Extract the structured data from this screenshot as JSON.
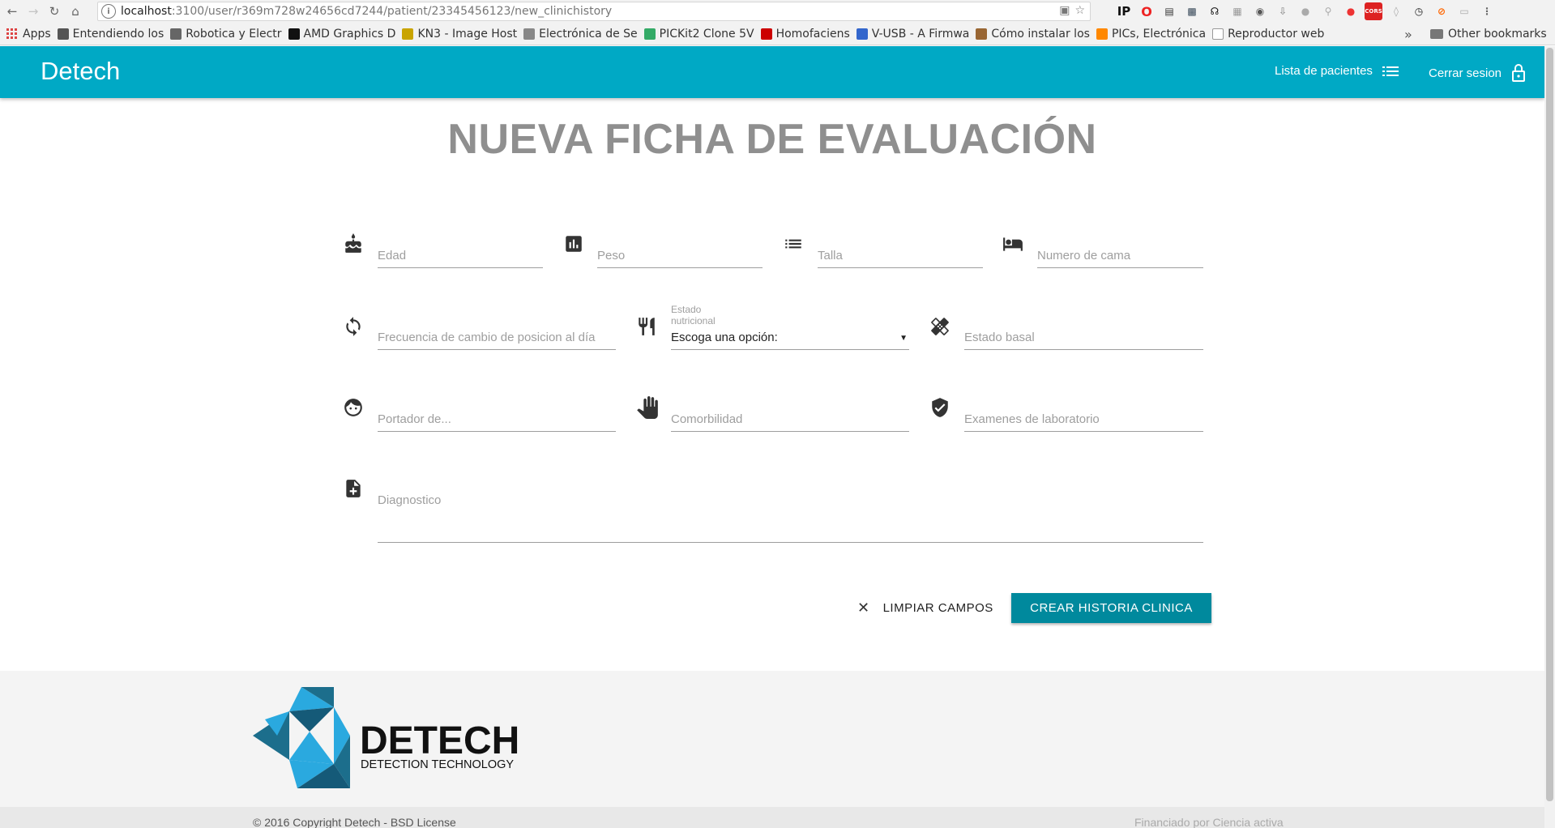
{
  "browser": {
    "url_host": "localhost",
    "url_path": ":3100/user/r369m728w24656cd7244/patient/23345456123/new_clinichistory",
    "bookmarks": [
      {
        "label": "Apps",
        "icon": "apps-grid-icon",
        "color": "#d44"
      },
      {
        "label": "Entendiendo los",
        "icon": "bookmark-favicon",
        "color": "#555"
      },
      {
        "label": "Robotica y Electr",
        "icon": "bookmark-favicon",
        "color": "#666"
      },
      {
        "label": "AMD Graphics D",
        "icon": "bookmark-favicon",
        "color": "#111"
      },
      {
        "label": "KN3 - Image Host",
        "icon": "bookmark-favicon",
        "color": "#c9a400"
      },
      {
        "label": "Electrónica de Se",
        "icon": "bookmark-favicon",
        "color": "#888"
      },
      {
        "label": "PICKit2 Clone 5V",
        "icon": "bookmark-favicon",
        "color": "#3a6"
      },
      {
        "label": "Homofaciens",
        "icon": "bookmark-favicon",
        "color": "#c00"
      },
      {
        "label": "V-USB - A Firmwa",
        "icon": "bookmark-favicon",
        "color": "#36c"
      },
      {
        "label": "Cómo instalar los",
        "icon": "bookmark-favicon",
        "color": "#963"
      },
      {
        "label": "PICs, Electrónica",
        "icon": "bookmark-favicon",
        "color": "#f80"
      },
      {
        "label": "Reproductor web",
        "icon": "page-icon",
        "color": "#999"
      }
    ],
    "bookmarks_more": "»",
    "other_bookmarks": "Other bookmarks"
  },
  "header": {
    "brand": "Detech",
    "patients_link": "Lista de pacientes",
    "logout_link": "Cerrar sesion",
    "bg_color": "#00a9c5"
  },
  "page": {
    "title": "NUEVA FICHA DE EVALUACIÓN"
  },
  "form": {
    "edad": "Edad",
    "peso": "Peso",
    "talla": "Talla",
    "cama": "Numero de cama",
    "frecuencia": "Frecuencia de cambio de posicion al día",
    "estado_nutricional_label": "Estado nutricional",
    "estado_nutricional_value": "Escoga una opción:",
    "estado_basal": "Estado basal",
    "portador": "Portador de...",
    "comorbilidad": "Comorbilidad",
    "examenes": "Examenes de laboratorio",
    "diagnostico": "Diagnostico"
  },
  "actions": {
    "clear": "LIMPIAR CAMPOS",
    "create": "CREAR HISTORIA CLINICA",
    "create_color": "#00899d"
  },
  "footer": {
    "logo_title": "DETECH",
    "logo_subtitle": "DETECTION TECHNOLOGY",
    "copyright": "© 2016 Copyright Detech - BSD License",
    "funded": "Financiado por Ciencia activa"
  }
}
